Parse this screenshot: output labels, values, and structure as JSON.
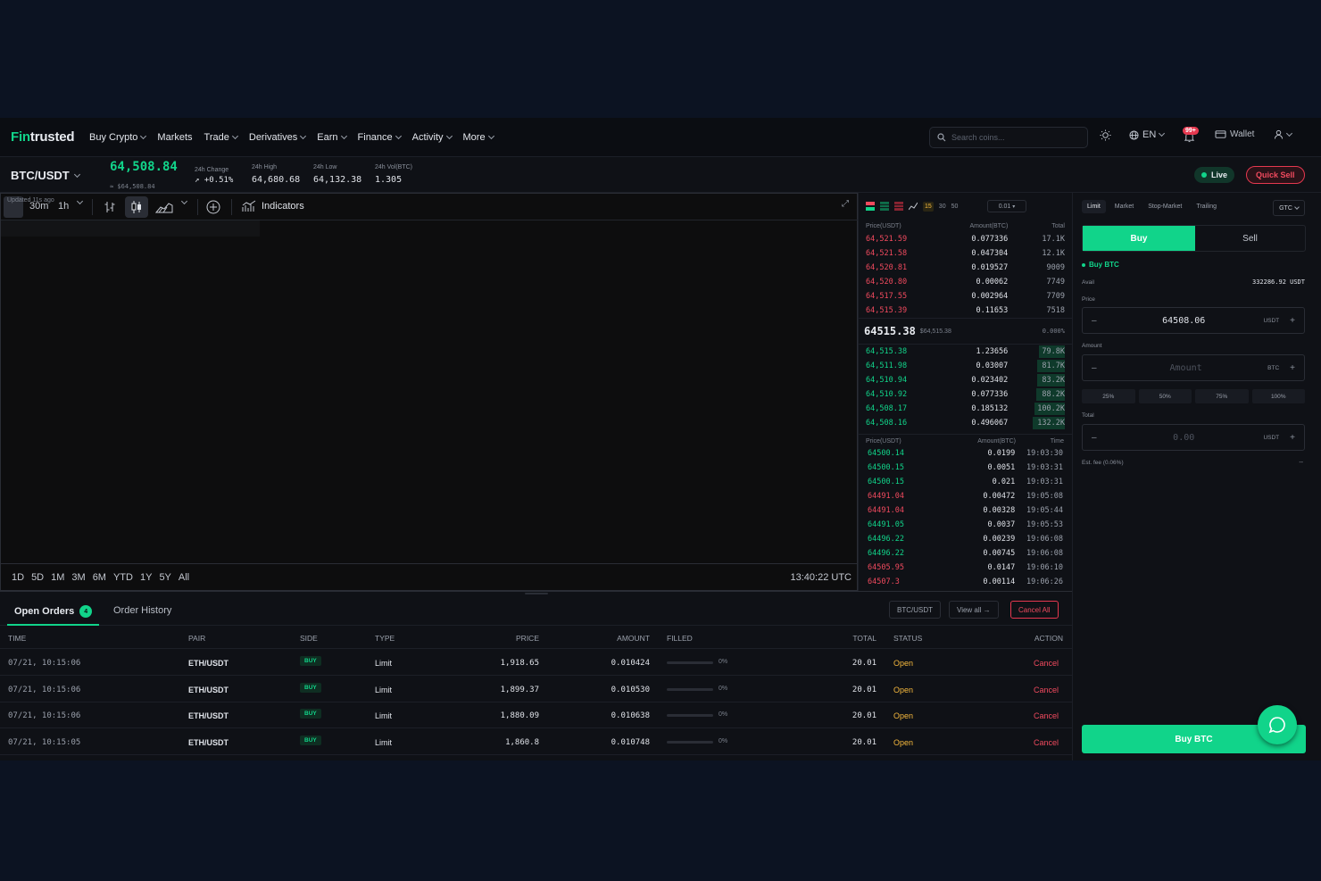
{
  "nav": {
    "logo_f": "Fin",
    "logo_rest": "trusted",
    "menu": [
      "Buy Crypto",
      "Markets",
      "Trade",
      "Derivatives",
      "Earn",
      "Finance",
      "Activity",
      "More"
    ],
    "search_placeholder": "Search coins...",
    "language": "EN",
    "notifications": "99+",
    "wallet": "Wallet"
  },
  "ticker": {
    "pair": "BTC/USDT",
    "last_price": "64,508.84",
    "last_usd": "≈ $64,508.84",
    "change_label": "24h Change",
    "change_value": "+0.51%",
    "high_label": "24h High",
    "high_value": "64,680.68",
    "low_label": "24h Low",
    "low_value": "64,132.38",
    "vol_label": "24h Vol(BTC)",
    "vol_value": "1.305",
    "live": "Live",
    "quick_sell": "Quick Sell"
  },
  "chart": {
    "updated": "Updated 11s ago",
    "interval": "30m",
    "interval2": "1h",
    "indicators": "Indicators",
    "ranges": [
      "1D",
      "5D",
      "1M",
      "3M",
      "6M",
      "YTD",
      "1Y",
      "5Y",
      "All"
    ],
    "utc_time": "13:40:22 UTC"
  },
  "orderbook": {
    "levels": [
      "15",
      "30",
      "50"
    ],
    "tick": "0.01",
    "head": {
      "price": "Price(USDT)",
      "amount": "Amount(BTC)",
      "total": "Total"
    },
    "asks": [
      {
        "p": "64,521.59",
        "a": "0.077336",
        "t": "17.1K"
      },
      {
        "p": "64,521.58",
        "a": "0.047304",
        "t": "12.1K"
      },
      {
        "p": "64,520.81",
        "a": "0.019527",
        "t": "9009"
      },
      {
        "p": "64,520.80",
        "a": "0.00062",
        "t": "7749"
      },
      {
        "p": "64,517.55",
        "a": "0.002964",
        "t": "7709"
      },
      {
        "p": "64,515.39",
        "a": "0.11653",
        "t": "7518"
      }
    ],
    "mid_price": "64515.38",
    "mid_usd": "$64,515.38",
    "mid_pct": "0.000%",
    "bids": [
      {
        "p": "64,515.38",
        "a": "1.23656",
        "t": "79.8K",
        "depth": 0.16
      },
      {
        "p": "64,511.98",
        "a": "0.03007",
        "t": "81.7K",
        "depth": 0.17
      },
      {
        "p": "64,510.94",
        "a": "0.023402",
        "t": "83.2K",
        "depth": 0.17
      },
      {
        "p": "64,510.92",
        "a": "0.077336",
        "t": "88.2K",
        "depth": 0.18
      },
      {
        "p": "64,508.17",
        "a": "0.185132",
        "t": "100.2K",
        "depth": 0.19
      },
      {
        "p": "64,508.16",
        "a": "0.496067",
        "t": "132.2K",
        "depth": 0.2
      }
    ],
    "trades_head": {
      "price": "Price(USDT)",
      "amount": "Amount(BTC)",
      "time": "Time"
    },
    "trades": [
      {
        "p": "64500.14",
        "a": "0.0199",
        "t": "19:03:30",
        "side": "buy"
      },
      {
        "p": "64500.15",
        "a": "0.0051",
        "t": "19:03:31",
        "side": "buy"
      },
      {
        "p": "64500.15",
        "a": "0.021",
        "t": "19:03:31",
        "side": "buy"
      },
      {
        "p": "64491.04",
        "a": "0.00472",
        "t": "19:05:08",
        "side": "sell"
      },
      {
        "p": "64491.04",
        "a": "0.00328",
        "t": "19:05:44",
        "side": "sell"
      },
      {
        "p": "64491.05",
        "a": "0.0037",
        "t": "19:05:53",
        "side": "buy"
      },
      {
        "p": "64496.22",
        "a": "0.00239",
        "t": "19:06:08",
        "side": "buy"
      },
      {
        "p": "64496.22",
        "a": "0.00745",
        "t": "19:06:08",
        "side": "buy"
      },
      {
        "p": "64505.95",
        "a": "0.0147",
        "t": "19:06:10",
        "side": "sell"
      },
      {
        "p": "64507.3",
        "a": "0.00114",
        "t": "19:06:26",
        "side": "sell"
      }
    ]
  },
  "form": {
    "order_types": [
      "Limit",
      "Market",
      "Stop-Market",
      "Trailing"
    ],
    "tif": "GTC",
    "buy_tab": "Buy",
    "sell_tab": "Sell",
    "buy_label": "Buy BTC",
    "avail_label": "Avail",
    "avail_value": "332286.92 USDT",
    "price_label": "Price",
    "price_value": "64508.06",
    "price_cur": "USDT",
    "amount_label": "Amount",
    "amount_placeholder": "Amount",
    "amount_cur": "BTC",
    "percents": [
      "25%",
      "50%",
      "75%",
      "100%"
    ],
    "total_label": "Total",
    "total_placeholder": "0.00",
    "total_cur": "USDT",
    "fee_label": "Est. fee (0.06%)",
    "fee_value": "--",
    "submit": "Buy BTC"
  },
  "orders": {
    "tab_open": "Open Orders",
    "open_count": "4",
    "tab_history": "Order History",
    "filter_pair": "BTC/USDT",
    "view_all": "View all",
    "cancel_all": "Cancel All",
    "columns": [
      "TIME",
      "PAIR",
      "SIDE",
      "TYPE",
      "PRICE",
      "AMOUNT",
      "FILLED",
      "TOTAL",
      "STATUS",
      "ACTION"
    ],
    "rows": [
      {
        "time": "07/21, 10:15:06",
        "pair": "ETH/USDT",
        "side": "BUY",
        "type": "Limit",
        "price": "1,918.65",
        "amount": "0.010424",
        "filled": "0%",
        "total": "20.01",
        "status": "Open",
        "action": "Cancel"
      },
      {
        "time": "07/21, 10:15:06",
        "pair": "ETH/USDT",
        "side": "BUY",
        "type": "Limit",
        "price": "1,899.37",
        "amount": "0.010530",
        "filled": "0%",
        "total": "20.01",
        "status": "Open",
        "action": "Cancel"
      },
      {
        "time": "07/21, 10:15:06",
        "pair": "ETH/USDT",
        "side": "BUY",
        "type": "Limit",
        "price": "1,880.09",
        "amount": "0.010638",
        "filled": "0%",
        "total": "20.01",
        "status": "Open",
        "action": "Cancel"
      },
      {
        "time": "07/21, 10:15:05",
        "pair": "ETH/USDT",
        "side": "BUY",
        "type": "Limit",
        "price": "1,860.8",
        "amount": "0.010748",
        "filled": "0%",
        "total": "20.01",
        "status": "Open",
        "action": "Cancel"
      }
    ]
  },
  "colors": {
    "accent": "#11d48a",
    "sell": "#f04a5e",
    "open": "#f5b83d",
    "bg": "#0c1322"
  }
}
